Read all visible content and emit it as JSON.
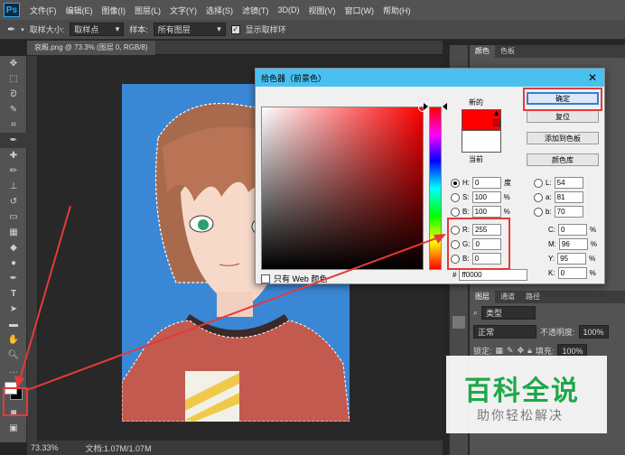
{
  "menubar": {
    "logo": "Ps",
    "items": [
      "文件(F)",
      "编辑(E)",
      "图像(I)",
      "图层(L)",
      "文字(Y)",
      "选择(S)",
      "滤镜(T)",
      "3D(D)",
      "视图(V)",
      "窗口(W)",
      "帮助(H)"
    ]
  },
  "optbar": {
    "sample_size_label": "取样大小:",
    "sample_size_value": "取样点",
    "sample_label": "样本:",
    "sample_value": "所有图层",
    "show_ring_label": "显示取样环",
    "show_ring_checked": true
  },
  "document": {
    "tab_title": "哀殿.png @ 73.3% (图层 0, RGB/8)",
    "close": "×"
  },
  "status": {
    "zoom": "73.33%",
    "doc_info": "文档:1.07M/1.07M"
  },
  "right_panel": {
    "top_tabs": [
      "颜色",
      "色板"
    ],
    "layer_tabs": [
      "图层",
      "通道",
      "路径"
    ],
    "kind_label": "类型",
    "blend_mode": "正常",
    "opacity_label": "不透明度:",
    "opacity_value": "100%",
    "lock_label": "锁定:",
    "fill_label": "填充:",
    "fill_value": "100%"
  },
  "dialog": {
    "title": "拾色器（前景色）",
    "close": "✕",
    "new_label": "新的",
    "current_label": "当前",
    "web_only_label": "只有 Web 颜色",
    "buttons": {
      "ok": "确定",
      "reset": "复位",
      "add_to_swatches": "添加到色板",
      "color_libraries": "颜色库"
    },
    "hsb": [
      {
        "label": "H:",
        "value": "0",
        "unit": "度",
        "selected": true
      },
      {
        "label": "S:",
        "value": "100",
        "unit": "%",
        "selected": false
      },
      {
        "label": "B:",
        "value": "100",
        "unit": "%",
        "selected": false
      }
    ],
    "rgb": [
      {
        "label": "R:",
        "value": "255"
      },
      {
        "label": "G:",
        "value": "0"
      },
      {
        "label": "B:",
        "value": "0"
      }
    ],
    "lab": [
      {
        "label": "L:",
        "value": "54"
      },
      {
        "label": "a:",
        "value": "81"
      },
      {
        "label": "b:",
        "value": "70"
      }
    ],
    "cmyk": [
      {
        "label": "C:",
        "value": "0",
        "unit": "%"
      },
      {
        "label": "M:",
        "value": "96",
        "unit": "%"
      },
      {
        "label": "Y:",
        "value": "95",
        "unit": "%"
      },
      {
        "label": "K:",
        "value": "0",
        "unit": "%"
      }
    ],
    "hex_label": "#",
    "hex_value": "ff0000",
    "new_color": "#ff0000",
    "current_color": "#ffffff"
  },
  "watermark": {
    "title": "百科全说",
    "subtitle": "助你轻松解决"
  }
}
